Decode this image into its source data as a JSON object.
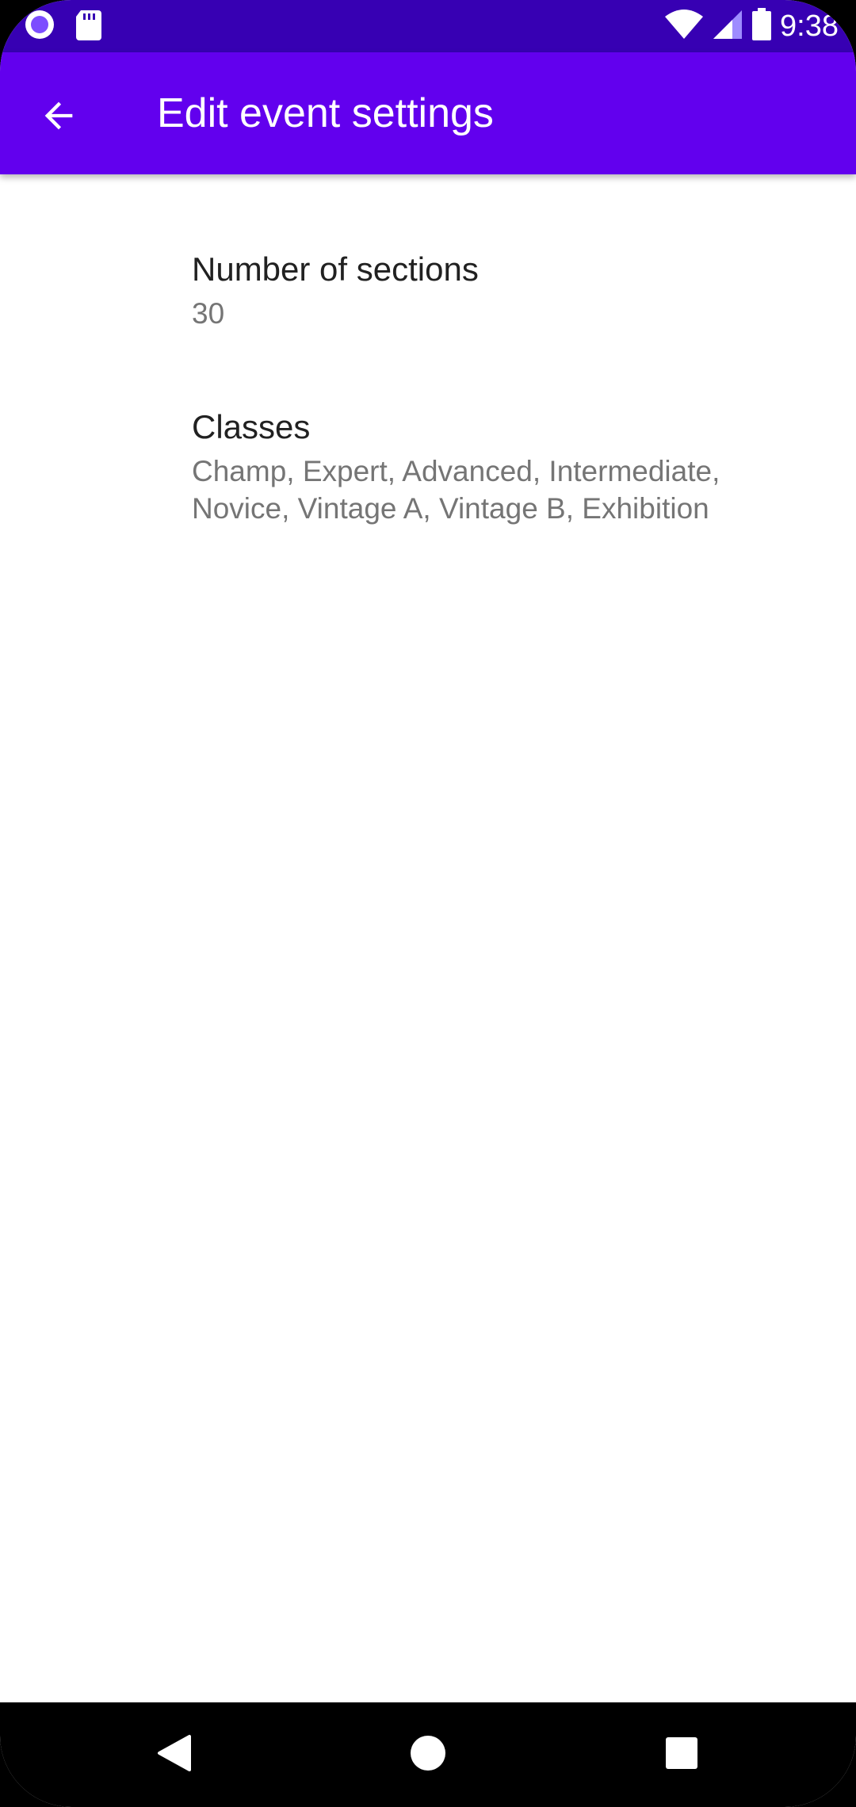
{
  "status_bar": {
    "time": "9:38",
    "icons": [
      "notification-circle-icon",
      "sd-card-icon",
      "wifi-icon",
      "signal-icon",
      "battery-icon"
    ]
  },
  "app_bar": {
    "title": "Edit event settings",
    "back_icon": "arrow-back-icon",
    "color": "#6200ee",
    "status_color": "#3700b3"
  },
  "preferences": [
    {
      "title": "Number of sections",
      "summary": "30"
    },
    {
      "title": "Classes",
      "summary": "Champ, Expert, Advanced, Intermediate, Novice, Vintage A, Vintage B, Exhibition"
    }
  ],
  "nav_bar": {
    "back_icon": "nav-back-icon",
    "home_icon": "nav-home-icon",
    "recents_icon": "nav-recents-icon"
  }
}
